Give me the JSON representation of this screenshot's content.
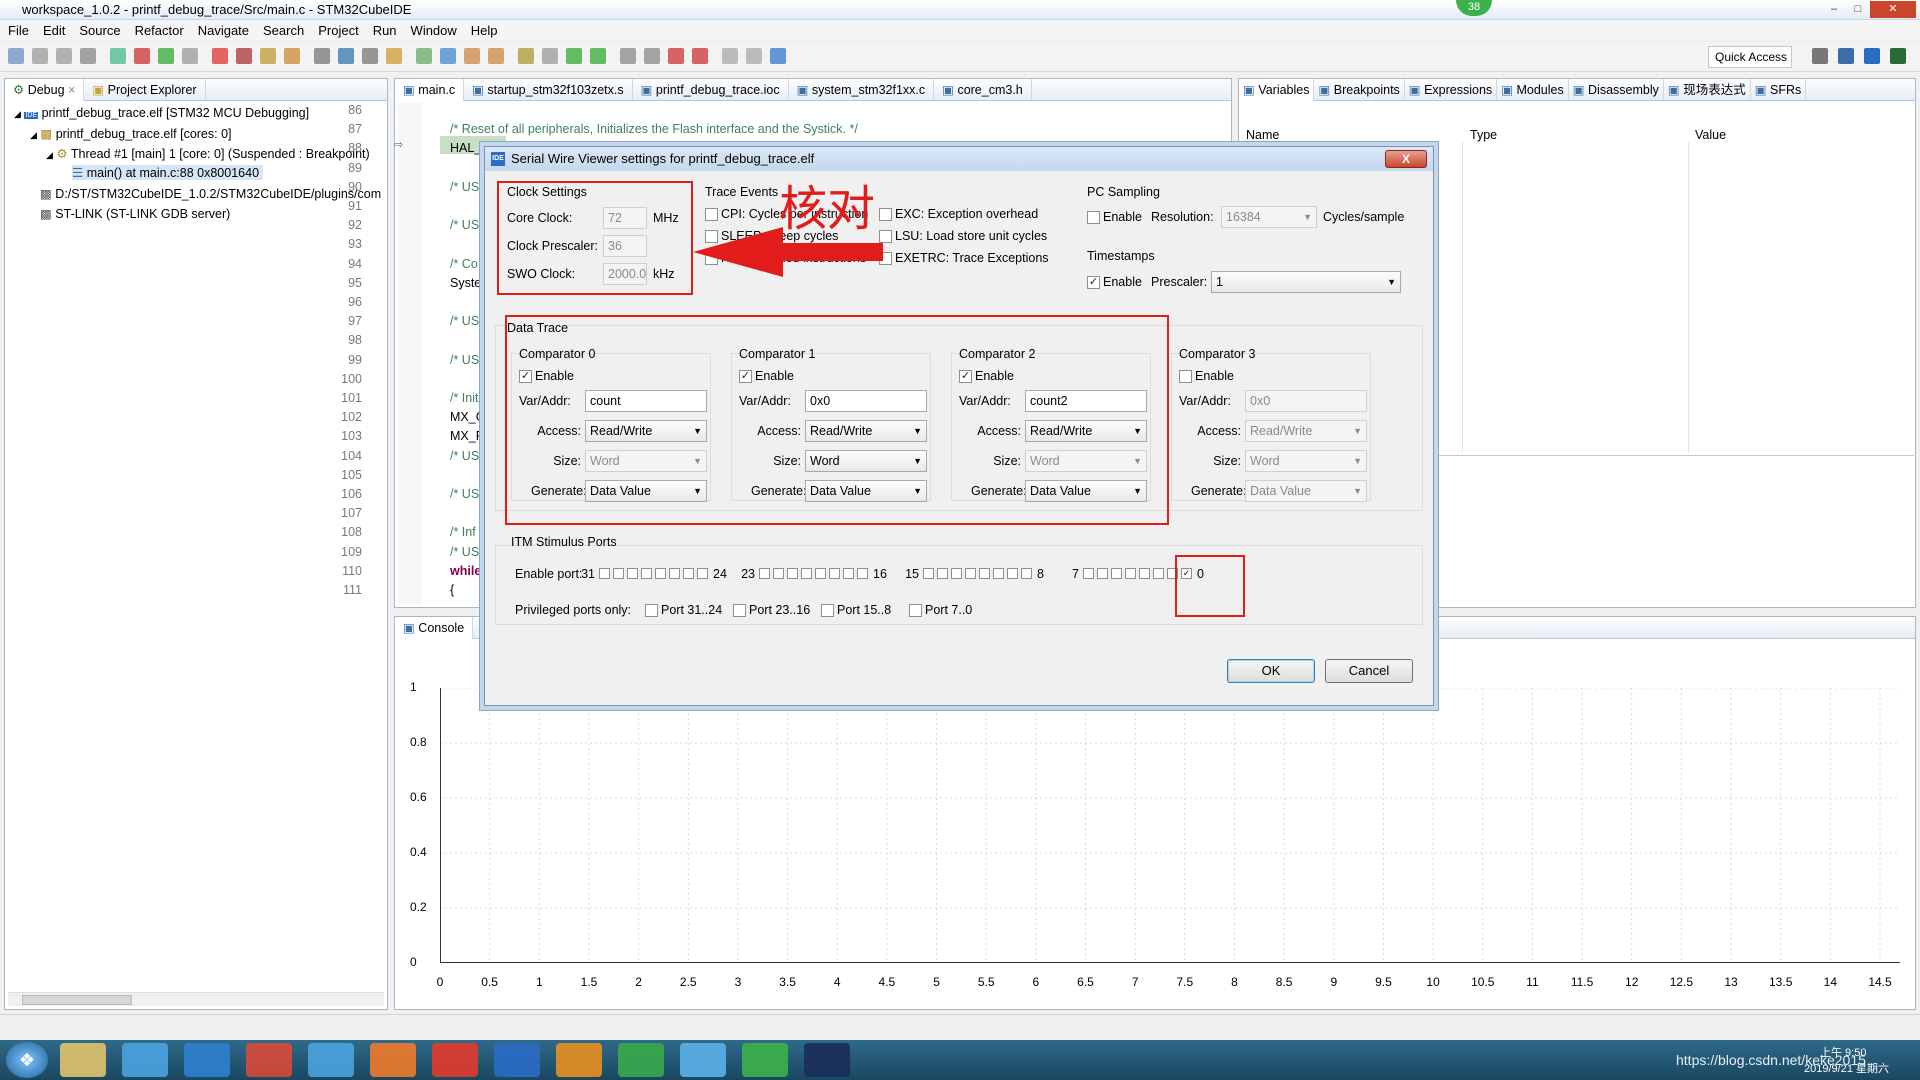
{
  "window": {
    "title": "workspace_1.0.2 - printf_debug_trace/Src/main.c - STM32CubeIDE",
    "icon": "IDE",
    "badge": "38"
  },
  "menu": [
    "File",
    "Edit",
    "Source",
    "Refactor",
    "Navigate",
    "Search",
    "Project",
    "Run",
    "Window",
    "Help"
  ],
  "quick_access": "Quick Access",
  "left_panel": {
    "tabs": [
      "Debug",
      "Project Explorer"
    ],
    "tree": [
      "printf_debug_trace.elf [STM32 MCU Debugging]",
      "printf_debug_trace.elf [cores: 0]",
      "Thread #1 [main] 1 [core: 0] (Suspended : Breakpoint)",
      "main() at main.c:88 0x8001640",
      "D:/ST/STM32CubeIDE_1.0.2/STM32CubeIDE/plugins/com",
      "ST-LINK (ST-LINK GDB server)"
    ]
  },
  "editor": {
    "tabs": [
      "main.c",
      "startup_stm32f103zetx.s",
      "printf_debug_trace.ioc",
      "system_stm32f1xx.c",
      "core_cm3.h"
    ],
    "lines": [
      {
        "n": "86",
        "t": ""
      },
      {
        "n": "87",
        "t": "/* Reset of all peripherals, Initializes the Flash interface and the Systick. */"
      },
      {
        "n": "88",
        "t": "HAL_Init();"
      },
      {
        "n": "89",
        "t": ""
      },
      {
        "n": "90",
        "t": "/* US"
      },
      {
        "n": "91",
        "t": ""
      },
      {
        "n": "92",
        "t": "/* US"
      },
      {
        "n": "93",
        "t": ""
      },
      {
        "n": "94",
        "t": "/* Co"
      },
      {
        "n": "95",
        "t": "Syster"
      },
      {
        "n": "96",
        "t": ""
      },
      {
        "n": "97",
        "t": "/* US"
      },
      {
        "n": "98",
        "t": ""
      },
      {
        "n": "99",
        "t": "/* US"
      },
      {
        "n": "100",
        "t": ""
      },
      {
        "n": "101",
        "t": "/* Init"
      },
      {
        "n": "102",
        "t": "MX_G"
      },
      {
        "n": "103",
        "t": "MX_R"
      },
      {
        "n": "104",
        "t": "/* US"
      },
      {
        "n": "105",
        "t": ""
      },
      {
        "n": "106",
        "t": "/* US"
      },
      {
        "n": "107",
        "t": ""
      },
      {
        "n": "108",
        "t": "/* Inf"
      },
      {
        "n": "109",
        "t": "/* US"
      },
      {
        "n": "110",
        "t": "while"
      },
      {
        "n": "111",
        "t": "{"
      }
    ]
  },
  "right_panel": {
    "tabs": [
      "Variables",
      "Breakpoints",
      "Expressions",
      "Modules",
      "Disassembly",
      "现场表达式",
      "SFRs"
    ],
    "columns": [
      "Name",
      "Type",
      "Value"
    ]
  },
  "console": {
    "tab": "Console"
  },
  "chart_data": {
    "type": "line",
    "x_ticks": [
      "0",
      "0.5",
      "1",
      "1.5",
      "2",
      "2.5",
      "3",
      "3.5",
      "4",
      "4.5",
      "5",
      "5.5",
      "6",
      "6.5",
      "7",
      "7.5",
      "8",
      "8.5",
      "9",
      "9.5",
      "10",
      "10.5",
      "11",
      "11.5",
      "12",
      "12.5",
      "13",
      "13.5",
      "14",
      "14.5"
    ],
    "y_ticks": [
      "0",
      "0.2",
      "0.4",
      "0.6",
      "0.8",
      "1"
    ],
    "xlim": [
      0,
      14.5
    ],
    "ylim": [
      0,
      1
    ],
    "grid": true,
    "series": []
  },
  "dialog": {
    "title": "Serial Wire Viewer settings for printf_debug_trace.elf",
    "close": "X",
    "annotation": "核对",
    "clock": {
      "title": "Clock Settings",
      "core_label": "Core Clock:",
      "core_value": "72",
      "core_unit": "MHz",
      "prescaler_label": "Clock Prescaler:",
      "prescaler_value": "36",
      "swo_label": "SWO Clock:",
      "swo_value": "2000.0",
      "swo_unit": "kHz"
    },
    "trace_events": {
      "title": "Trace Events",
      "items": [
        {
          "label": "CPI: Cycles per instruction",
          "checked": false
        },
        {
          "label": "SLEEP: Sleep cycles",
          "checked": false
        },
        {
          "label": "FOLD: Folded instructions",
          "checked": false
        },
        {
          "label": "EXC: Exception overhead",
          "checked": false
        },
        {
          "label": "LSU: Load store unit cycles",
          "checked": false
        },
        {
          "label": "EXETRC: Trace Exceptions",
          "checked": false
        }
      ]
    },
    "pc_sampling": {
      "title": "PC Sampling",
      "enable": "Enable",
      "resolution_label": "Resolution:",
      "resolution_value": "16384",
      "unit": "Cycles/sample"
    },
    "timestamps": {
      "title": "Timestamps",
      "enable": "Enable",
      "prescaler_label": "Prescaler:",
      "prescaler_value": "1"
    },
    "data_trace": {
      "title": "Data Trace",
      "labels": {
        "enable": "Enable",
        "var": "Var/Addr:",
        "access": "Access:",
        "size": "Size:",
        "generate": "Generate:"
      },
      "comparators": [
        {
          "title": "Comparator 0",
          "enabled": true,
          "var": "count",
          "access": "Read/Write",
          "size": "Word",
          "size_enabled": false,
          "generate": "Data Value"
        },
        {
          "title": "Comparator 1",
          "enabled": true,
          "var": "0x0",
          "access": "Read/Write",
          "size": "Word",
          "size_enabled": true,
          "generate": "Data Value"
        },
        {
          "title": "Comparator 2",
          "enabled": true,
          "var": "count2",
          "access": "Read/Write",
          "size": "Word",
          "size_enabled": false,
          "generate": "Data Value"
        },
        {
          "title": "Comparator 3",
          "enabled": false,
          "var": "0x0",
          "access": "Read/Write",
          "size": "Word",
          "size_enabled": false,
          "generate": "Data Value"
        }
      ]
    },
    "itm": {
      "title": "ITM Stimulus Ports",
      "enable_label": "Enable port:",
      "groups": [
        {
          "start": "31",
          "end": "24"
        },
        {
          "start": "23",
          "end": "16"
        },
        {
          "start": "15",
          "end": "8"
        },
        {
          "start": "7",
          "end": "0"
        }
      ],
      "privileged_label": "Privileged ports only:",
      "privileged": [
        "Port 31..24",
        "Port 23..16",
        "Port 15..8",
        "Port 7..0"
      ]
    },
    "ok": "OK",
    "cancel": "Cancel"
  },
  "taskbar": {
    "clock_time": "上午 9:50",
    "clock_date": "2019/9/21 星期六",
    "watermark": "https://blog.csdn.net/keke2015"
  }
}
